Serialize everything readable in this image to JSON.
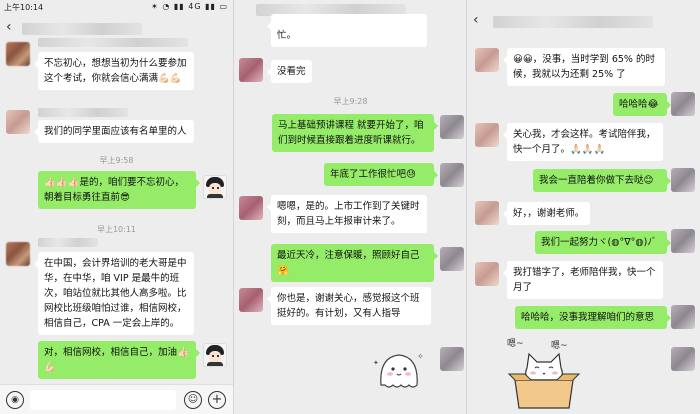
{
  "status_bar": {
    "time": "上午10:14",
    "network": "4G"
  },
  "panel1": {
    "messages": [
      {
        "text": "不忘初心，想想当初为什么要参加这个考试，你就会信心满满💪🏻💪🏻",
        "side": "left"
      },
      {
        "text": "我们的同学里面应该有名单里的人",
        "side": "left"
      },
      {
        "time": "早上9:58"
      },
      {
        "text": "👍🏻👍🏻👍🏻是的，咱们要不忘初心，朝着目标勇往直前😎",
        "side": "right"
      },
      {
        "time": "早上10:11"
      },
      {
        "text": "在中国，会计界培训的老大哥是中华，在中华，咱 VIP 是最牛的班次，咱站位就比其他人高多啦。比网校比班级咱怕过谁，相信网校，相信自己，CPA 一定会上岸的。",
        "side": "left"
      },
      {
        "text": "对，相信网校，相信自己，加油👍🏻💪🏻",
        "side": "right"
      }
    ],
    "input_icons": [
      "voice-icon",
      "emoji-icon",
      "plus-icon"
    ]
  },
  "panel2": {
    "messages": [
      {
        "text": "忙。",
        "side": "left"
      },
      {
        "text": "没看完",
        "side": "left"
      },
      {
        "time": "早上9:28"
      },
      {
        "text": "马上基础预讲课程 就要开始了，咱们到时候直接跟着进度听课就行。",
        "side": "right"
      },
      {
        "text": "年底了工作很忙吧😓",
        "side": "right"
      },
      {
        "text": "嗯嗯，是的。上市工作到了关键时刻，而且马上年报审计来了。",
        "side": "left"
      },
      {
        "text": "最近天冷，注意保暖，照顾好自己🤗",
        "side": "right"
      },
      {
        "text": "你也是，谢谢关心，感觉报这个班挺好的。有计划，又有人指导",
        "side": "left"
      }
    ]
  },
  "panel3": {
    "messages": [
      {
        "text": "😀😀，没事，当时学到 65% 的时候，我就以为还剩 25% 了",
        "side": "left"
      },
      {
        "text": "哈哈哈😂",
        "side": "right"
      },
      {
        "text": "关心我，才会这样。考试陪伴我，快一个月了。🙏🏻🙏🏻🙏🏻",
        "side": "left"
      },
      {
        "text": "我会一直陪着你做下去哒😊",
        "side": "right"
      },
      {
        "text": "好，，谢谢老师。",
        "side": "left"
      },
      {
        "text": "我们一起努力ヾ(◍°∇°◍)ﾉﾞ",
        "side": "right"
      },
      {
        "text": "我打错字了，老师陪伴我，快一个月了",
        "side": "left"
      },
      {
        "text": "哈哈哈，没事我理解咱们的意思",
        "side": "right"
      }
    ]
  },
  "colors": {
    "chat_bg": "#ededed",
    "self_bubble": "#95ec69",
    "other_bubble": "#ffffff"
  }
}
